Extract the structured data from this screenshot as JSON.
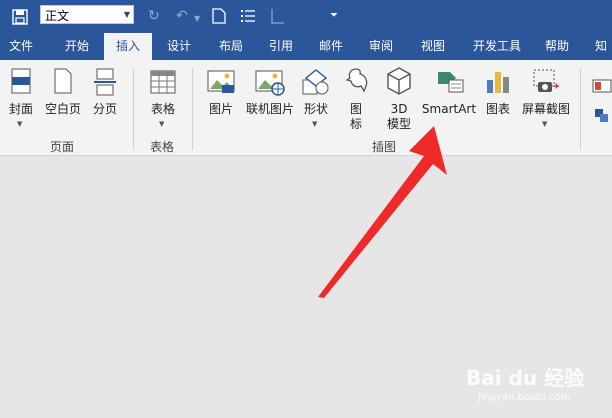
{
  "qat": {
    "style_value": "正文",
    "icons": [
      "save-icon",
      "refresh-icon",
      "undo-icon",
      "new-doc-icon",
      "list-icon",
      "blank-icon",
      "customize-icon"
    ]
  },
  "tabs": [
    "文件",
    "开始",
    "插入",
    "设计",
    "布局",
    "引用",
    "邮件",
    "审阅",
    "视图",
    "开发工具",
    "帮助",
    "知"
  ],
  "active_tab": "插入",
  "ribbon": {
    "pages": {
      "label": "页面",
      "cover": "封面",
      "blank": "空白页",
      "break": "分页"
    },
    "tables": {
      "label": "表格",
      "table": "表格"
    },
    "illustrations": {
      "label": "插图",
      "picture": "图片",
      "online_picture": "联机图片",
      "shapes": "形状",
      "icons_line1": "图",
      "icons_line2": "标",
      "model_line1": "3D",
      "model_line2": "模型",
      "smartart": "SmartArt",
      "chart": "图表",
      "screenshot": "屏幕截图"
    }
  },
  "watermark": {
    "logo": "Bai du 经验",
    "url": "jingyan.baidu.com"
  },
  "colors": {
    "accent": "#2b579a",
    "arrow": "#ee2a2a",
    "ribbon_bg": "#f3f3f3",
    "doc_bg": "#e6e6e6"
  }
}
